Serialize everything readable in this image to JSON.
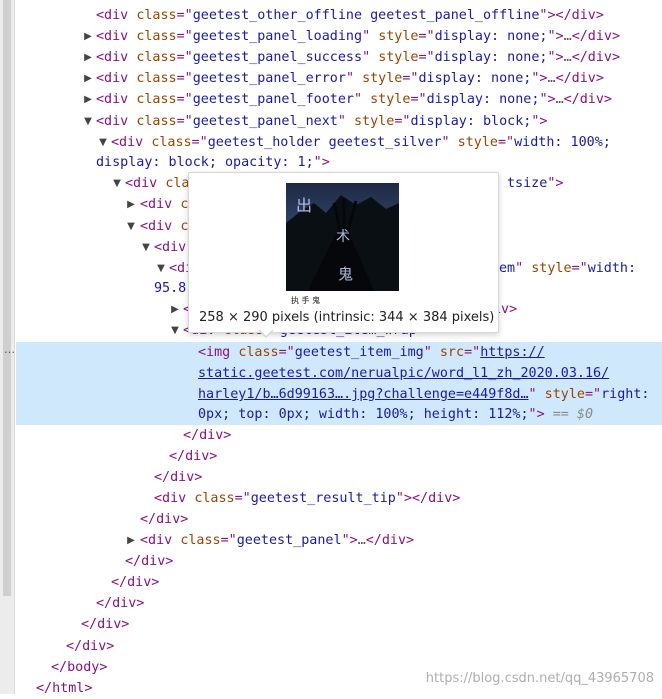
{
  "rows": [
    {
      "id": "r0",
      "parts": [
        {
          "c": "tag",
          "t": "<div "
        },
        {
          "c": "an",
          "t": "class"
        },
        {
          "c": "tag",
          "t": "=\""
        },
        {
          "c": "av",
          "t": "geetest_other_offline geetest_panel_offline"
        },
        {
          "c": "tag",
          "t": "\">"
        },
        {
          "c": "tag",
          "t": "</div>"
        }
      ]
    },
    {
      "id": "r1",
      "tw": "▶",
      "parts": [
        {
          "c": "tag",
          "t": "<div "
        },
        {
          "c": "an",
          "t": "class"
        },
        {
          "c": "tag",
          "t": "=\""
        },
        {
          "c": "av",
          "t": "geetest_panel_loading"
        },
        {
          "c": "tag",
          "t": "\" "
        },
        {
          "c": "an",
          "t": "style"
        },
        {
          "c": "tag",
          "t": "=\""
        },
        {
          "c": "av",
          "t": "display: none;"
        },
        {
          "c": "tag",
          "t": "\">"
        },
        {
          "c": "ell",
          "t": "…"
        },
        {
          "c": "tag",
          "t": "</div>"
        }
      ]
    },
    {
      "id": "r2",
      "tw": "▶",
      "parts": [
        {
          "c": "tag",
          "t": "<div "
        },
        {
          "c": "an",
          "t": "class"
        },
        {
          "c": "tag",
          "t": "=\""
        },
        {
          "c": "av",
          "t": "geetest_panel_success"
        },
        {
          "c": "tag",
          "t": "\" "
        },
        {
          "c": "an",
          "t": "style"
        },
        {
          "c": "tag",
          "t": "=\""
        },
        {
          "c": "av",
          "t": "display: none;"
        },
        {
          "c": "tag",
          "t": "\">"
        },
        {
          "c": "ell",
          "t": "…"
        },
        {
          "c": "tag",
          "t": "</div>"
        }
      ]
    },
    {
      "id": "r3",
      "tw": "▶",
      "parts": [
        {
          "c": "tag",
          "t": "<div "
        },
        {
          "c": "an",
          "t": "class"
        },
        {
          "c": "tag",
          "t": "=\""
        },
        {
          "c": "av",
          "t": "geetest_panel_error"
        },
        {
          "c": "tag",
          "t": "\" "
        },
        {
          "c": "an",
          "t": "style"
        },
        {
          "c": "tag",
          "t": "=\""
        },
        {
          "c": "av",
          "t": "display: none;"
        },
        {
          "c": "tag",
          "t": "\">"
        },
        {
          "c": "ell",
          "t": "…"
        },
        {
          "c": "tag",
          "t": "</div>"
        }
      ]
    },
    {
      "id": "r4",
      "tw": "▶",
      "parts": [
        {
          "c": "tag",
          "t": "<div "
        },
        {
          "c": "an",
          "t": "class"
        },
        {
          "c": "tag",
          "t": "=\""
        },
        {
          "c": "av",
          "t": "geetest_panel_footer"
        },
        {
          "c": "tag",
          "t": "\" "
        },
        {
          "c": "an",
          "t": "style"
        },
        {
          "c": "tag",
          "t": "=\""
        },
        {
          "c": "av",
          "t": "display: none;"
        },
        {
          "c": "tag",
          "t": "\">"
        },
        {
          "c": "ell",
          "t": "…"
        },
        {
          "c": "tag",
          "t": "</div>"
        }
      ]
    },
    {
      "id": "r5",
      "tw": "▼",
      "parts": [
        {
          "c": "tag",
          "t": "<div "
        },
        {
          "c": "an",
          "t": "class"
        },
        {
          "c": "tag",
          "t": "=\""
        },
        {
          "c": "av",
          "t": "geetest_panel_next"
        },
        {
          "c": "tag",
          "t": "\" "
        },
        {
          "c": "an",
          "t": "style"
        },
        {
          "c": "tag",
          "t": "=\""
        },
        {
          "c": "av",
          "t": "display: block;"
        },
        {
          "c": "tag",
          "t": "\">"
        }
      ]
    },
    {
      "id": "r6",
      "tw": "▼",
      "parts": [
        {
          "c": "tag",
          "t": "<div "
        },
        {
          "c": "an",
          "t": "class"
        },
        {
          "c": "tag",
          "t": "=\""
        },
        {
          "c": "av",
          "t": "geetest_holder geetest_silver"
        },
        {
          "c": "tag",
          "t": "\" "
        },
        {
          "c": "an",
          "t": "style"
        },
        {
          "c": "tag",
          "t": "=\""
        },
        {
          "c": "av",
          "t": "width: 100%;"
        }
      ]
    },
    {
      "id": "r6b",
      "parts": [
        {
          "c": "av",
          "t": "display: block; opacity: 1;"
        },
        {
          "c": "tag",
          "t": "\">"
        }
      ]
    },
    {
      "id": "r7",
      "tw": "▼",
      "parts": [
        {
          "c": "tag",
          "t": "<div "
        },
        {
          "c": "an",
          "t": "cla"
        }
      ]
    },
    {
      "id": "r7t",
      "parts": [
        {
          "c": "av",
          "t": "tsize"
        },
        {
          "c": "tag",
          "t": "\">"
        }
      ]
    },
    {
      "id": "r8",
      "tw": "▶",
      "parts": [
        {
          "c": "tag",
          "t": "<div "
        },
        {
          "c": "an",
          "t": "c"
        }
      ]
    },
    {
      "id": "r9",
      "tw": "▼",
      "parts": [
        {
          "c": "tag",
          "t": "<div "
        },
        {
          "c": "an",
          "t": "c"
        }
      ]
    },
    {
      "id": "r10",
      "tw": "▼",
      "parts": [
        {
          "c": "tag",
          "t": "<div"
        }
      ]
    },
    {
      "id": "r11",
      "tw": "▼",
      "parts": [
        {
          "c": "tag",
          "t": "<di"
        }
      ]
    },
    {
      "id": "r11t",
      "parts": [
        {
          "c": "av",
          "t": "em"
        },
        {
          "c": "tag",
          "t": "\" "
        },
        {
          "c": "an",
          "t": "style"
        },
        {
          "c": "tag",
          "t": "=\""
        },
        {
          "c": "av",
          "t": "width:"
        }
      ]
    },
    {
      "id": "r11b",
      "parts": [
        {
          "c": "av",
          "t": "95.8"
        }
      ]
    },
    {
      "id": "r12",
      "tw": "▶",
      "parts": [
        {
          "c": "tag",
          "t": "<"
        }
      ]
    },
    {
      "id": "r12t",
      "parts": [
        {
          "c": "tag",
          "t": "iv>"
        }
      ]
    },
    {
      "id": "r13",
      "tw": "▼",
      "parts": [
        {
          "c": "tag",
          "t": "<div "
        },
        {
          "c": "an",
          "t": "class"
        },
        {
          "c": "tag",
          "t": "=\""
        },
        {
          "c": "av",
          "t": "geetest_item_wrap"
        },
        {
          "c": "tag",
          "t": "\">"
        }
      ]
    },
    {
      "id": "r14",
      "parts": [
        {
          "c": "tag",
          "t": "<img "
        },
        {
          "c": "an",
          "t": "class"
        },
        {
          "c": "tag",
          "t": "=\""
        },
        {
          "c": "av",
          "t": "geetest_item_img"
        },
        {
          "c": "tag",
          "t": "\" "
        },
        {
          "c": "an",
          "t": "src"
        },
        {
          "c": "tag",
          "t": "=\""
        },
        {
          "c": "lnk",
          "t": "https://"
        }
      ]
    },
    {
      "id": "r15",
      "parts": [
        {
          "c": "lnk",
          "t": "static.geetest.com/nerualpic/word_l1_zh_2020.03.16/"
        }
      ]
    },
    {
      "id": "r16",
      "parts": [
        {
          "c": "lnk",
          "t": "harley1/b…6d99163….jpg?challenge=e449f8d…"
        },
        {
          "c": "tag",
          "t": "\" "
        },
        {
          "c": "an",
          "t": "style"
        },
        {
          "c": "tag",
          "t": "=\""
        },
        {
          "c": "av",
          "t": "right:"
        }
      ]
    },
    {
      "id": "r17",
      "parts": [
        {
          "c": "av",
          "t": "0px; top: 0px; width: 100%; height: 112%;"
        },
        {
          "c": "tag",
          "t": "\">"
        },
        {
          "c": "dim",
          "t": " == $0"
        }
      ]
    },
    {
      "id": "r18",
      "parts": [
        {
          "c": "tag",
          "t": "</div>"
        }
      ]
    },
    {
      "id": "r19",
      "parts": [
        {
          "c": "tag",
          "t": "</div>"
        }
      ]
    },
    {
      "id": "r20",
      "parts": [
        {
          "c": "tag",
          "t": "</div>"
        }
      ]
    },
    {
      "id": "r21",
      "parts": [
        {
          "c": "tag",
          "t": "<div "
        },
        {
          "c": "an",
          "t": "class"
        },
        {
          "c": "tag",
          "t": "=\""
        },
        {
          "c": "av",
          "t": "geetest_result_tip"
        },
        {
          "c": "tag",
          "t": "\">"
        },
        {
          "c": "tag",
          "t": "</div>"
        }
      ]
    },
    {
      "id": "r22",
      "parts": [
        {
          "c": "tag",
          "t": "</div>"
        }
      ]
    },
    {
      "id": "r23",
      "tw": "▶",
      "parts": [
        {
          "c": "tag",
          "t": "<div "
        },
        {
          "c": "an",
          "t": "class"
        },
        {
          "c": "tag",
          "t": "=\""
        },
        {
          "c": "av",
          "t": "geetest_panel"
        },
        {
          "c": "tag",
          "t": "\">"
        },
        {
          "c": "ell",
          "t": "…"
        },
        {
          "c": "tag",
          "t": "</div>"
        }
      ]
    },
    {
      "id": "r24",
      "parts": [
        {
          "c": "tag",
          "t": "</div>"
        }
      ]
    },
    {
      "id": "r25",
      "parts": [
        {
          "c": "tag",
          "t": "</div>"
        }
      ]
    },
    {
      "id": "r26",
      "parts": [
        {
          "c": "tag",
          "t": "</div>"
        }
      ]
    },
    {
      "id": "r27",
      "parts": [
        {
          "c": "tag",
          "t": "</div>"
        }
      ]
    },
    {
      "id": "r28",
      "parts": [
        {
          "c": "tag",
          "t": "</div>"
        }
      ]
    },
    {
      "id": "r29",
      "parts": [
        {
          "c": "tag",
          "t": "</body>"
        }
      ]
    },
    {
      "id": "r30",
      "parts": [
        {
          "c": "tag",
          "t": "</html>"
        }
      ]
    }
  ],
  "selected_row_dots": "…",
  "tooltip": {
    "dimensions": "258 × 290 pixels (intrinsic: 344 × 384 pixels)",
    "captcha_chars": [
      "出",
      "术",
      "鬼"
    ],
    "captcha_hint": "执 手 鬼"
  },
  "watermark": "https://blog.csdn.net/qq_43965708",
  "colors": {
    "tag": "#881280",
    "attr_name": "#994500",
    "attr_value": "#1a1aa6",
    "selection": "#cfe8fc"
  }
}
